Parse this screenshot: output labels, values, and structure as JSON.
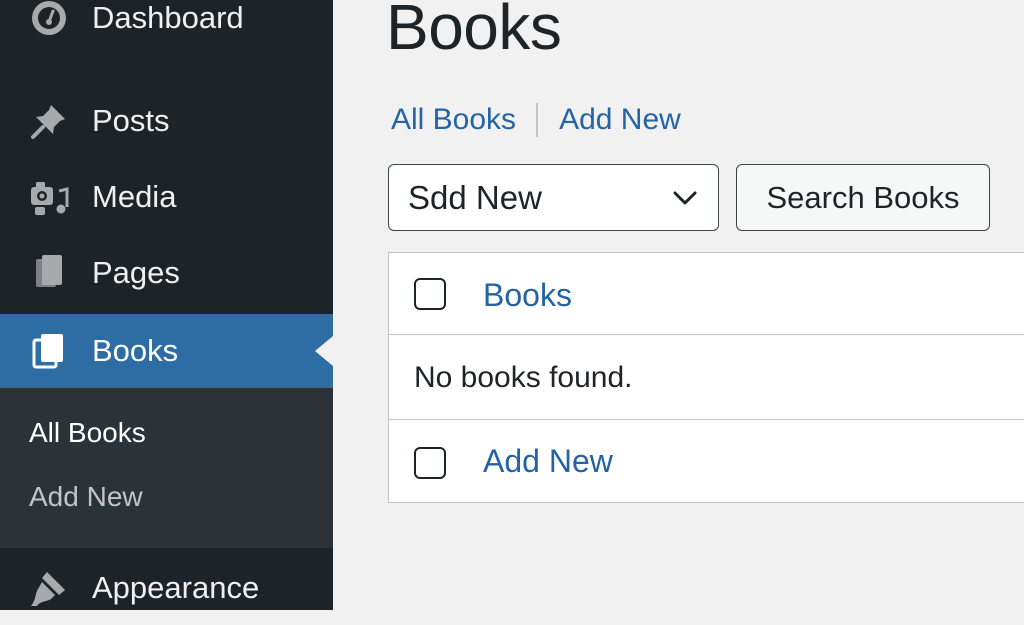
{
  "sidebar": {
    "items": [
      {
        "label": "Dashboard",
        "icon": "dashboard-icon"
      },
      {
        "label": "Posts",
        "icon": "pushpin-icon"
      },
      {
        "label": "Media",
        "icon": "media-icon"
      },
      {
        "label": "Pages",
        "icon": "pages-icon"
      },
      {
        "label": "Books",
        "icon": "book-icon",
        "current": true
      },
      {
        "label": "Appearance",
        "icon": "paintbrush-icon"
      }
    ],
    "submenu": [
      {
        "label": "All Books",
        "active": true
      },
      {
        "label": "Add New",
        "active": false
      }
    ]
  },
  "main": {
    "title": "Books",
    "subnav": {
      "all": "All Books",
      "add_new": "Add New"
    },
    "bulk_select": {
      "value": "Sdd New"
    },
    "search_button": "Search Books",
    "table": {
      "header": "Books",
      "empty_message": "No books found.",
      "footer": "Add New"
    }
  },
  "colors": {
    "sidebar_bg": "#1d2327",
    "submenu_bg": "#2c3338",
    "current_bg": "#2e6da4",
    "link": "#2463a4",
    "page_bg": "#f1f1f1"
  }
}
